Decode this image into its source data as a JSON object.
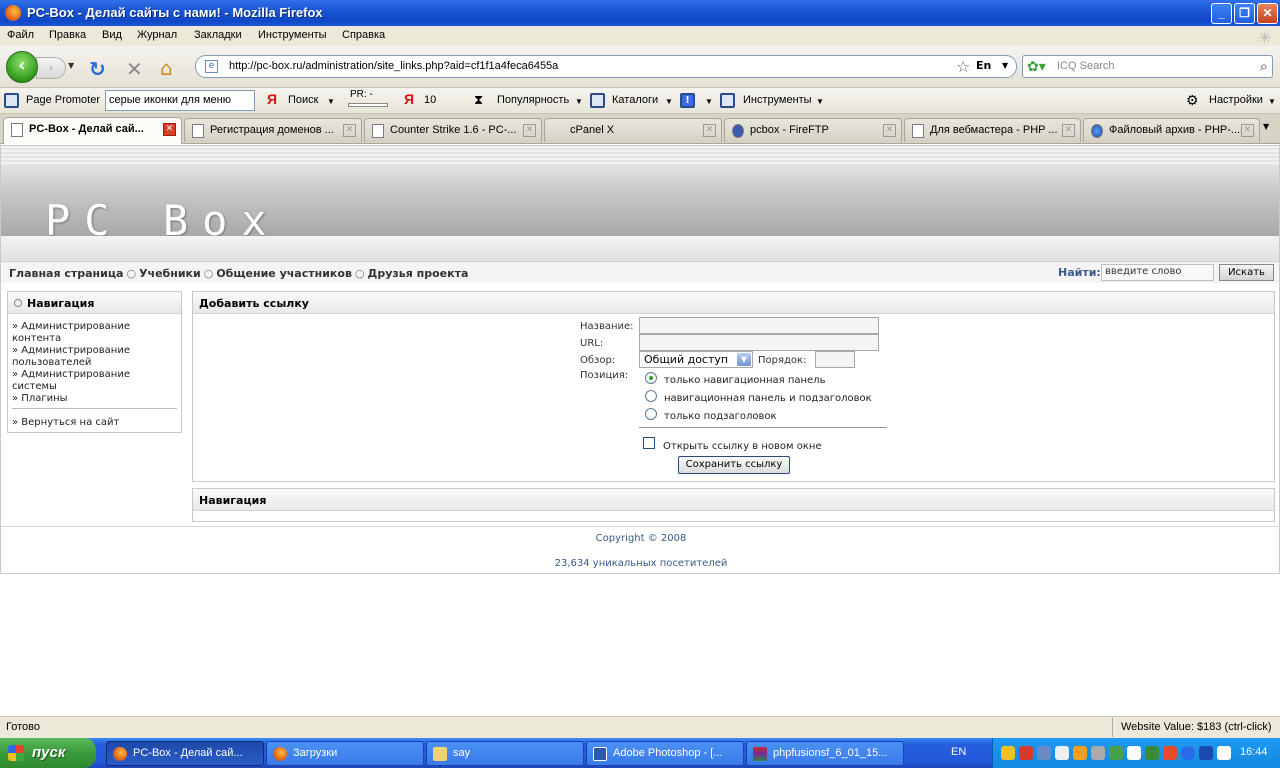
{
  "window": {
    "title": "PC-Box - Делай сайты с нами! - Mozilla Firefox"
  },
  "menu": [
    "Файл",
    "Правка",
    "Вид",
    "Журнал",
    "Закладки",
    "Инструменты",
    "Справка"
  ],
  "nav": {
    "url": "http://pc-box.ru/administration/site_links.php?aid=cf1f1a4feca6455a",
    "lang": "En",
    "search_placeholder": "ICQ Search"
  },
  "toolbar": {
    "page_promoter": "Page Promoter",
    "search_value": "серые иконки для меню",
    "poisk": "Поиск",
    "pr": "PR: -",
    "ya_count": "10",
    "popularity": "Популярность",
    "catalogs": "Каталоги",
    "tools": "Инструменты",
    "settings": "Настройки"
  },
  "tabs": [
    {
      "label": "PC-Box - Делай сай...",
      "active": true
    },
    {
      "label": "Регистрация доменов ..."
    },
    {
      "label": "Counter Strike 1.6 - PC-..."
    },
    {
      "label": "cPanel X"
    },
    {
      "label": "pcbox - FireFTP"
    },
    {
      "label": "Для вебмастера - PHP ..."
    },
    {
      "label": "Файловый архив - PHP-..."
    }
  ],
  "site": {
    "logo": "PC Box",
    "nav_links": [
      "Главная страница",
      "Учебники",
      "Общение участников",
      "Друзья проекта"
    ],
    "find_label": "Найти:",
    "find_placeholder": "введите слово",
    "find_button": "Искать",
    "sidebar": {
      "title": "Навигация",
      "links": [
        "Администрирование контента",
        "Администрирование пользователей",
        "Администрирование системы",
        "Плагины",
        "Вернуться на сайт"
      ]
    },
    "form": {
      "title": "Добавить ссылку",
      "name_label": "Название:",
      "url_label": "URL:",
      "view_label": "Обзор:",
      "view_value": "Общий доступ",
      "order_label": "Порядок:",
      "position_label": "Позиция:",
      "positions": [
        "только навигационная панель",
        "навигационная панель и подзаголовок",
        "только подзаголовок"
      ],
      "selected_position": 0,
      "new_window_label": "Открыть ссылку в новом окне",
      "save_button": "Сохранить ссылку"
    },
    "nav_box_title": "Навигация",
    "copyright": "Copyright © 2008",
    "visitors": "23,634 уникальных посетителей"
  },
  "status": {
    "text": "Готово",
    "website_value": "Website Value: $183 (ctrl-click)"
  },
  "taskbar": {
    "start": "пуск",
    "tasks": [
      "PC-Box - Делай сай...",
      "Загрузки",
      "say",
      "Adobe Photoshop - [...",
      "phpfusionsf_6_01_15..."
    ],
    "lang": "EN",
    "clock": "16:44"
  }
}
